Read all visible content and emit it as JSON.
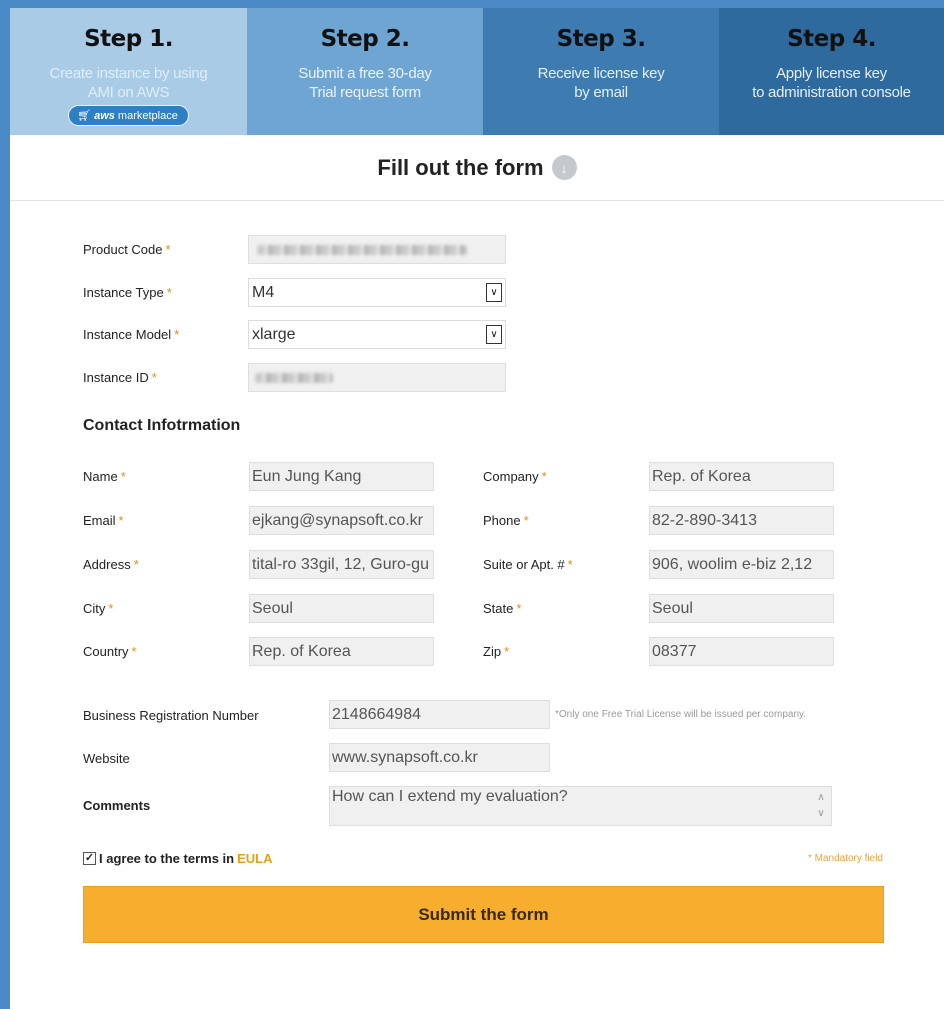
{
  "steps": [
    {
      "title": "Step 1.",
      "line1": "Create instance by using",
      "line2": "AMI on AWS",
      "badge": "marketplace",
      "badge_brand": "aws"
    },
    {
      "title": "Step 2.",
      "line1": "Submit a free 30-day",
      "line2": "Trial request form"
    },
    {
      "title": "Step 3.",
      "line1": "Receive license key",
      "line2": "by email"
    },
    {
      "title": "Step 4.",
      "line1": "Apply license key",
      "line2": "to  administration console"
    }
  ],
  "form_title": "Fill out the form",
  "required_mark": "*",
  "instance": {
    "product_code_label": "Product Code",
    "instance_type_label": "Instance Type",
    "instance_type_value": "M4",
    "instance_model_label": "Instance Model",
    "instance_model_value": "xlarge",
    "instance_id_label": "Instance ID"
  },
  "contact": {
    "heading": "Contact Infotrmation",
    "name_label": "Name",
    "name_value": "Eun Jung Kang",
    "company_label": "Company",
    "company_value": "Rep. of Korea",
    "email_label": "Email",
    "email_value": "ejkang@synapsoft.co.kr",
    "phone_label": "Phone",
    "phone_value": "82-2-890-3413",
    "address_label": "Address",
    "address_value": "tital-ro 33gil, 12, Guro-gu",
    "suite_label": "Suite or Apt. #",
    "suite_value": "906, woolim e-biz 2,12",
    "city_label": "City",
    "city_value": "Seoul",
    "state_label": "State",
    "state_value": "Seoul",
    "country_label": "Country",
    "country_value": "Rep. of Korea",
    "zip_label": "Zip",
    "zip_value": "08377"
  },
  "business": {
    "brn_label": "Business Registration Number",
    "brn_value": "2148664984",
    "brn_note": "*Only one Free Trial License will be issued per company.",
    "website_label": "Website",
    "website_value": "www.synapsoft.co.kr",
    "comments_label": "Comments",
    "comments_value": "How can I extend my evaluation?"
  },
  "agree": {
    "text": "I agree to the terms in",
    "link": "EULA",
    "checked": true
  },
  "mandatory_note": "* Mandatory field",
  "submit_label": "Submit the form",
  "colors": {
    "accent": "#f7ad2e",
    "frame": "#4a8ac6",
    "required": "#e88a1c"
  }
}
